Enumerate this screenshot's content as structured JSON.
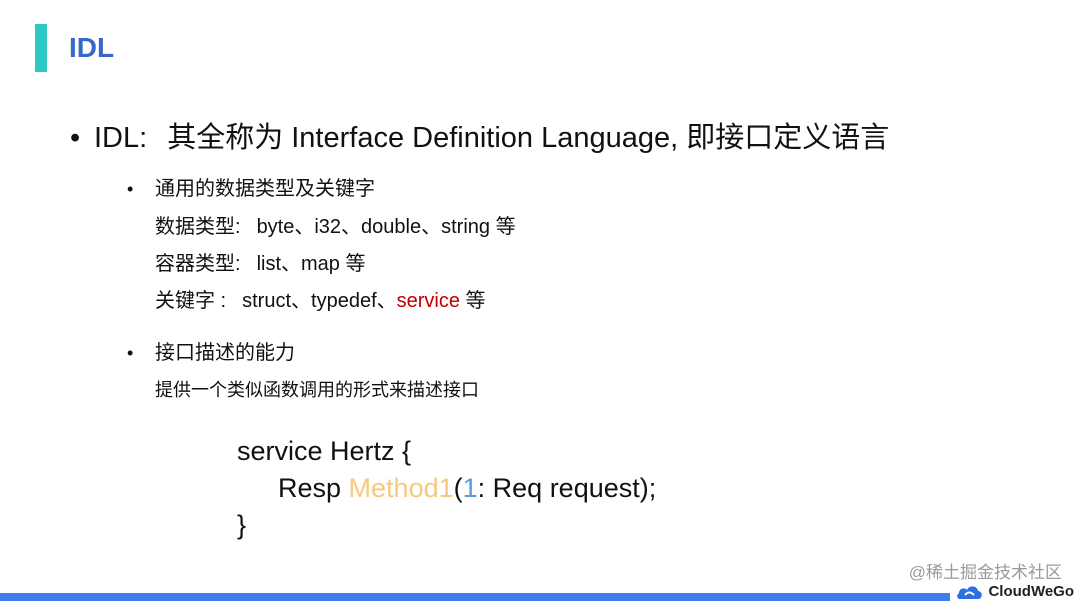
{
  "title": "IDL",
  "main_bullet": {
    "term": "IDL:",
    "description": "其全称为 Interface Definition Language, 即接口定义语言"
  },
  "section1": {
    "heading": "通用的数据类型及关键字",
    "rows": [
      {
        "label": "数据类型:",
        "value": "byte、i32、double、string 等"
      },
      {
        "label": "容器类型:",
        "value": "list、map 等"
      },
      {
        "label": "关键字 :",
        "value_prefix": "struct、typedef、",
        "value_highlight": "service",
        "value_suffix": " 等"
      }
    ]
  },
  "section2": {
    "heading": "接口描述的能力",
    "text": "提供一个类似函数调用的形式来描述接口"
  },
  "code": {
    "line1": "service Hertz {",
    "line2_type": "Resp ",
    "line2_method": "Method1",
    "line2_open": "(",
    "line2_num": "1",
    "line2_rest": ": Req request);",
    "line3": "}"
  },
  "watermark": "@稀土掘金技术社区",
  "brand": {
    "name": "CloudWeGo",
    "icon": "cloudwego-logo-icon"
  },
  "colors": {
    "accent": "#2ec8c4",
    "title": "#3b66c9",
    "highlight": "#c00000",
    "method": "#f5c97d",
    "number": "#5b9bd5",
    "footer": "#3d7ff0"
  }
}
